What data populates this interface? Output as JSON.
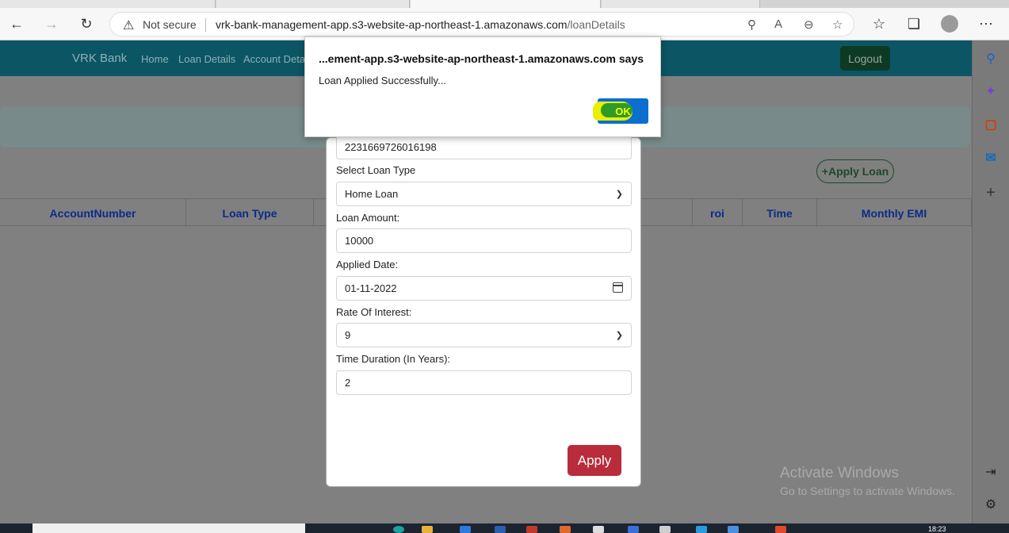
{
  "browser": {
    "security_label": "Not secure",
    "url_host": "vrk-bank-management-app.s3-website-ap-northeast-1.amazonaws.com",
    "url_path": "/loanDetails"
  },
  "nav": {
    "brand": "VRK Bank",
    "links": [
      "Home",
      "Loan Details",
      "Account Deta"
    ],
    "logout": "Logout"
  },
  "actions": {
    "apply_loan": "+Apply Loan"
  },
  "table": {
    "headers": [
      "AccountNumber",
      "Loan Type",
      "roi",
      "Time",
      "Monthly EMI"
    ]
  },
  "form": {
    "account_number": "2231669726016198",
    "loan_type_label": "Select Loan Type",
    "loan_type": "Home Loan",
    "amount_label": "Loan Amount:",
    "amount": "10000",
    "date_label": "Applied Date:",
    "date": "01-11-2022",
    "roi_label": "Rate Of Interest:",
    "roi": "9",
    "duration_label": "Time Duration (In Years):",
    "duration": "2",
    "apply": "Apply"
  },
  "alert": {
    "title": "...ement-app.s3-website-ap-northeast-1.amazonaws.com says",
    "message": "Loan Applied Successfully...",
    "ok": "OK"
  },
  "watermark": {
    "line1": "Activate Windows",
    "line2": "Go to Settings to activate Windows."
  },
  "taskbar": {
    "time": "18:23"
  }
}
